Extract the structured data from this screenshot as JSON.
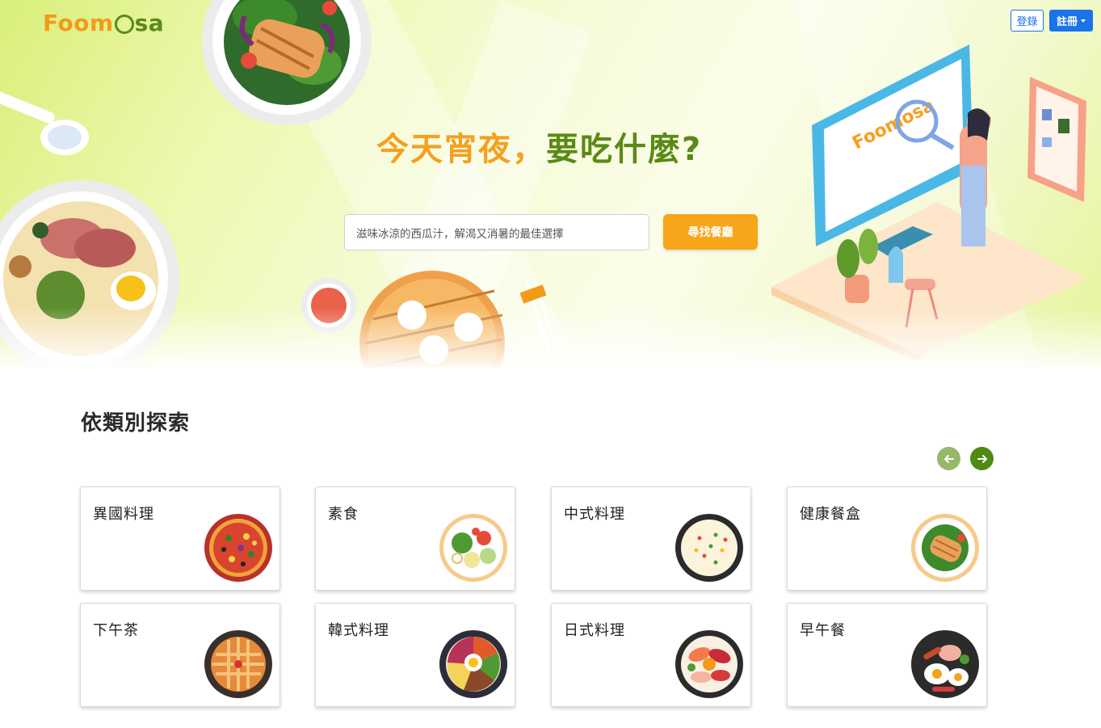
{
  "brand": {
    "logo_text_a": "Foom",
    "logo_text_b": "sa"
  },
  "header": {
    "login_label": "登錄",
    "register_label": "註冊"
  },
  "hero": {
    "headline_part1": "今天宵夜，",
    "headline_part2": "要吃什麼?",
    "search_placeholder": "滋味冰涼的西瓜汁，解渴又消暑的最佳選擇",
    "search_button": "尋找餐廳",
    "illustration_logo": "Foomosa"
  },
  "categories": {
    "title": "依類別探索",
    "prev_icon": "arrow-left-icon",
    "next_icon": "arrow-right-icon",
    "items": [
      {
        "label": "異國料理",
        "icon": "pizza-icon"
      },
      {
        "label": "素食",
        "icon": "salad-plate-icon"
      },
      {
        "label": "中式料理",
        "icon": "fried-rice-icon"
      },
      {
        "label": "健康餐盒",
        "icon": "chicken-salad-icon"
      },
      {
        "label": "下午茶",
        "icon": "pie-icon"
      },
      {
        "label": "韓式料理",
        "icon": "bibimbap-icon"
      },
      {
        "label": "日式料理",
        "icon": "sashimi-bowl-icon"
      },
      {
        "label": "早午餐",
        "icon": "breakfast-plate-icon"
      }
    ]
  },
  "colors": {
    "accent_orange": "#f7a51b",
    "brand_green": "#5a8a16",
    "primary_blue": "#1a73e8"
  }
}
